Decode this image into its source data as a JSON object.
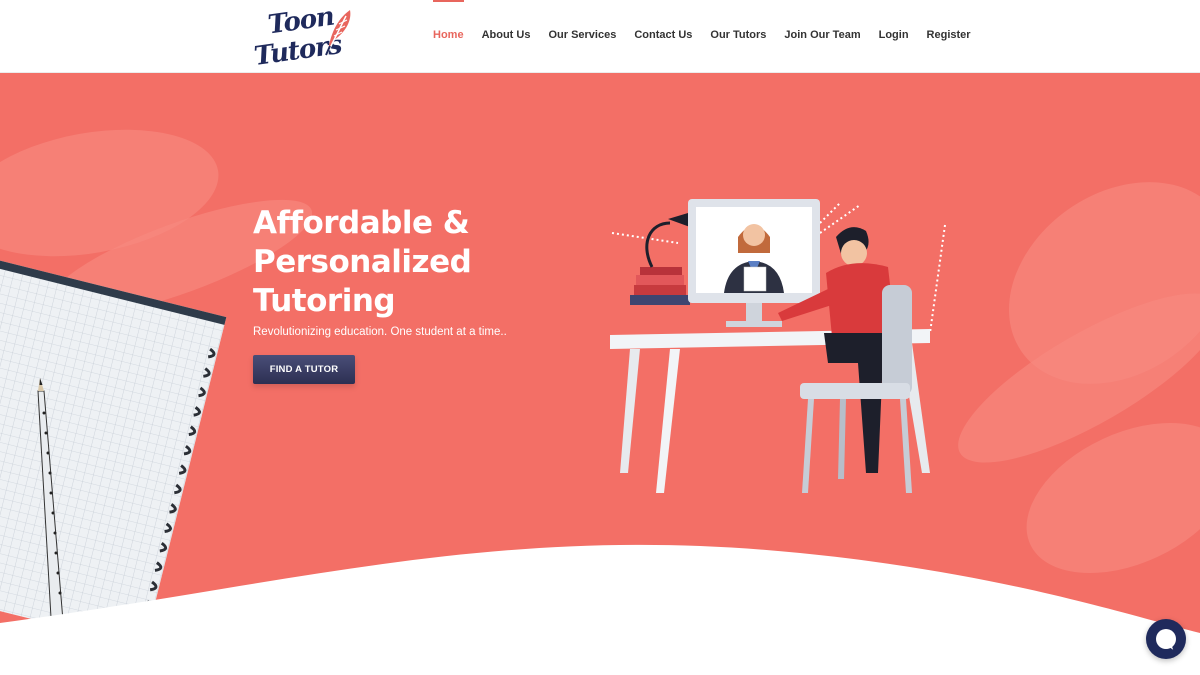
{
  "header": {
    "logo": {
      "line1": "Toon",
      "line2": "Tutors",
      "icon": "feather-quill-icon",
      "brand_color": "#1f2a5c",
      "accent_color": "#e8665d"
    },
    "nav": [
      {
        "label": "Home",
        "active": true
      },
      {
        "label": "About Us",
        "active": false
      },
      {
        "label": "Our Services",
        "active": false
      },
      {
        "label": "Contact Us",
        "active": false
      },
      {
        "label": "Our Tutors",
        "active": false
      },
      {
        "label": "Join Our Team",
        "active": false
      },
      {
        "label": "Login",
        "active": false
      },
      {
        "label": "Register",
        "active": false
      }
    ]
  },
  "hero": {
    "background_color": "#f36f66",
    "title_lines": [
      "Affordable &",
      "Personalized",
      "Tutoring"
    ],
    "subtitle": "Revolutionizing education. One student at a time..",
    "cta_label": "FIND A TUTOR",
    "illustration": "online-tutoring-desk-illustration",
    "decoration": "spiral-notebook-with-pencil"
  },
  "chat": {
    "icon": "chat-bubble-icon",
    "color": "#1f2a5c"
  }
}
